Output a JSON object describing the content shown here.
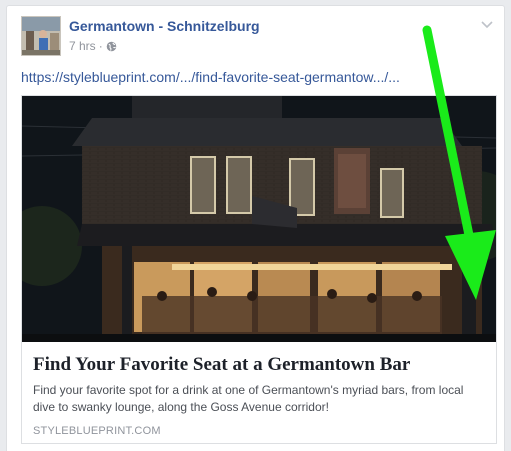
{
  "post": {
    "page_name": "Germantown - Schnitzelburg",
    "timestamp": "7 hrs",
    "audience_icon": "globe-icon",
    "menu_icon": "chevron-down-icon",
    "link_text": "https://styleblueprint.com/.../find-favorite-seat-germantow.../..."
  },
  "link_card": {
    "title": "Find Your Favorite Seat at a Germantown Bar",
    "description": "Find your favorite spot for a drink at one of Germantown's myriad bars, from local dive to swanky lounge, along the Goss Avenue corridor!",
    "domain": "STYLEBLUEPRINT.COM"
  },
  "annotation": {
    "arrow_color": "#1aeb1a"
  }
}
